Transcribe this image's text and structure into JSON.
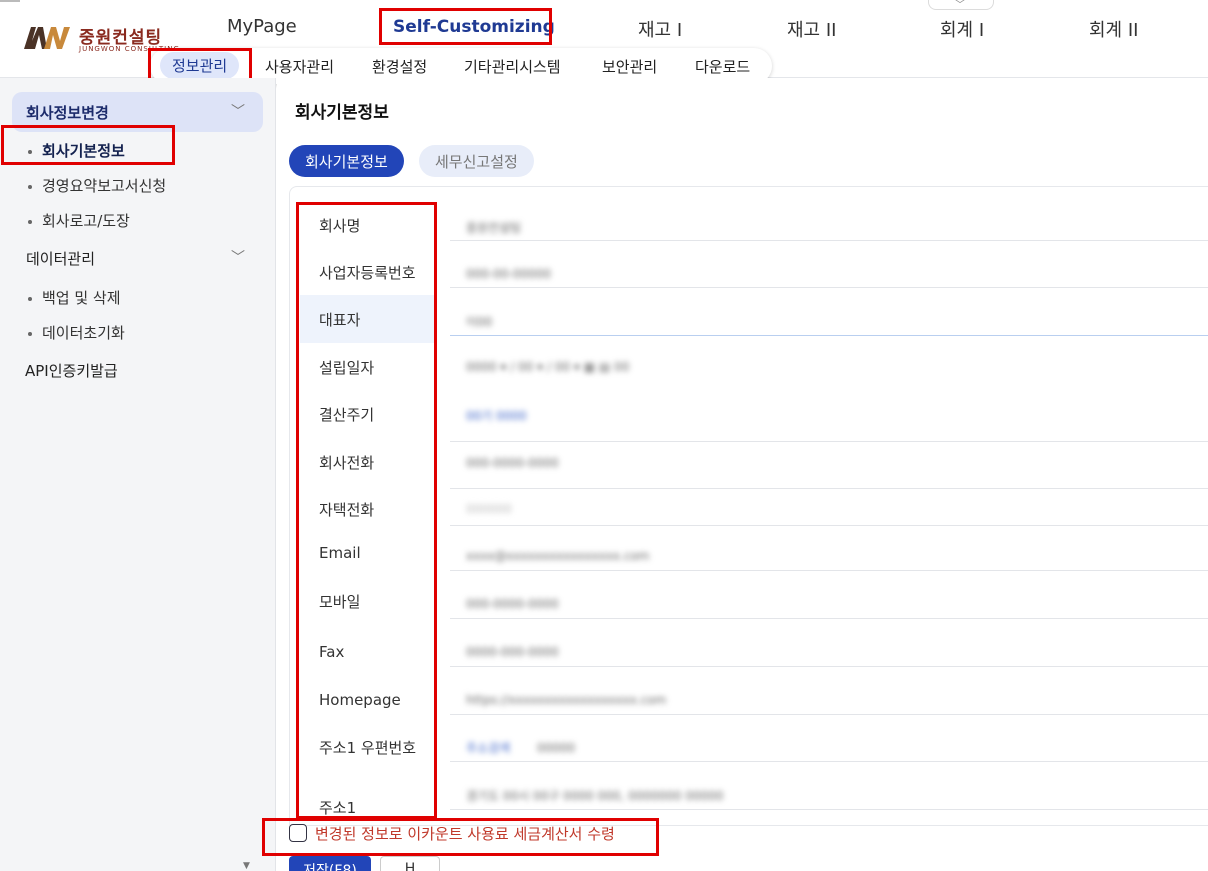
{
  "brand": {
    "name": "중원컨설팅",
    "sub": "JUNGWON CONSULTING"
  },
  "main_nav": [
    "MyPage",
    "Self-Customizing",
    "재고 I",
    "재고 II",
    "회계 I",
    "회계 II"
  ],
  "sub_nav": [
    "정보관리",
    "사용자관리",
    "환경설정",
    "기타관리시스템",
    "보안관리",
    "다운로드"
  ],
  "sidebar": {
    "group1": "회사정보변경",
    "group1_items": [
      "회사기본정보",
      "경영요약보고서신청",
      "회사로고/도장"
    ],
    "group2": "데이터관리",
    "group2_items": [
      "백업 및 삭제",
      "데이터초기화"
    ],
    "api": "API인증키발급"
  },
  "page": {
    "title": "회사기본정보",
    "tabs": [
      "회사기본정보",
      "세무신고설정"
    ]
  },
  "form": {
    "labels": [
      "회사명",
      "사업자등록번호",
      "대표자",
      "설립일자",
      "결산주기",
      "회사전화",
      "자택전화",
      "Email",
      "모바일",
      "Fax",
      "Homepage",
      "주소1 우편번호",
      "주소1"
    ]
  },
  "agree_label": "변경된 정보로 이카운트 사용료 세금계산서 수령",
  "buttons": {
    "save": "저장(F8)",
    "other": "H"
  },
  "colors": {
    "accent": "#2245b8",
    "highlight": "#e00000",
    "warning_text": "#c0392b"
  }
}
